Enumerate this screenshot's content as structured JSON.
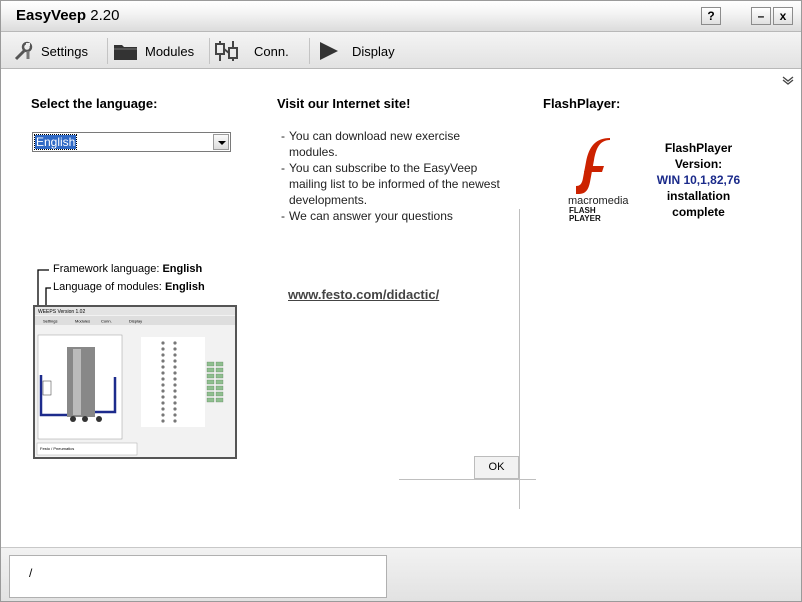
{
  "window": {
    "app_name": "EasyVeep",
    "version": "2.20",
    "help_label": "?",
    "minimize_label": "–",
    "close_label": "x"
  },
  "toolbar": {
    "items": [
      {
        "label": "Settings",
        "icon": "wrench-icon"
      },
      {
        "label": "Modules",
        "icon": "folder-icon"
      },
      {
        "label": "Conn.",
        "icon": "connector-icon"
      },
      {
        "label": "Display",
        "icon": "play-arrow-icon"
      }
    ]
  },
  "language": {
    "heading": "Select the language:",
    "selected": "English",
    "framework_label": "Framework language:",
    "framework_value": "English",
    "modules_label": "Language of modules:",
    "modules_value": "English"
  },
  "internet": {
    "heading": "Visit our Internet site!",
    "bullets": [
      "You can download new exercise modules.",
      "You can subscribe to the EasyVeep mailing list to be informed of the newest developments.",
      "We can answer your questions"
    ],
    "link": "www.festo.com/didactic/",
    "ok_label": "OK"
  },
  "flash": {
    "heading": "FlashPlayer:",
    "brand_top": "macromedia",
    "brand_flash": "FLASH",
    "brand_player": "PLAYER",
    "info_line1": "FlashPlayer",
    "info_line2": "Version:",
    "version": "WIN 10,1,82,76",
    "info_line4": "installation",
    "info_line5": "complete"
  },
  "preview": {
    "title": "WEEPS Version 1.02",
    "tabs": [
      "Settings",
      "Modules",
      "Conn.",
      "Display"
    ],
    "footer": "Festo / Pneumatics"
  },
  "status": {
    "text": "/"
  },
  "colors": {
    "flash_red": "#cc2200",
    "version_blue": "#1a2a8a",
    "selection_blue": "#316ac5"
  }
}
